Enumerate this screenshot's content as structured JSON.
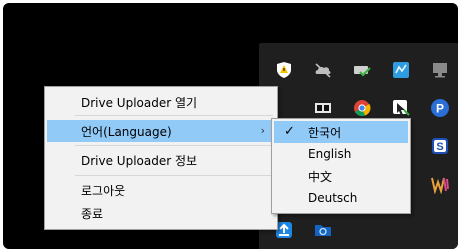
{
  "context_menu": {
    "items": [
      {
        "label": "Drive Uploader 열기"
      },
      {
        "label": "언어(Language)",
        "submenu_arrow": "›"
      },
      {
        "label": "Drive Uploader 정보"
      },
      {
        "label": "로그아웃"
      },
      {
        "label": "종료"
      }
    ]
  },
  "language_submenu": {
    "selected_mark": "✓",
    "items": [
      {
        "label": "한국어",
        "selected": true
      },
      {
        "label": "English"
      },
      {
        "label": "中文"
      },
      {
        "label": "Deutsch"
      }
    ]
  },
  "tray_icons": [
    "windows-security-icon",
    "onedrive-offline-icon",
    "network-check-icon",
    "audio-app-icon",
    "monitor-icon",
    "dolby-icon",
    "chrome-icon",
    "app-cursor-icon",
    "p-app-icon",
    "s-app-icon",
    "w-app-icon",
    "uploader-app-icon",
    "folder-sync-icon"
  ],
  "colors": {
    "highlight": "#91c9f7",
    "menu_bg": "#f2f2f2",
    "tray_bg": "#1f1f1f"
  }
}
